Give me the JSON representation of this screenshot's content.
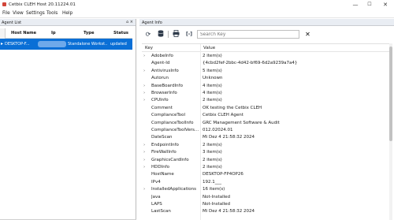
{
  "window": {
    "title": "Cetbix CLEH Host 20.11224.01",
    "minimize": "—",
    "maximize": "☐",
    "close": "✕"
  },
  "menu": [
    "File",
    "View",
    "Settings",
    "Tools",
    "Help"
  ],
  "agent_list": {
    "panel_title": "Agent List",
    "panel_icons": "⌂ ×",
    "columns": [
      "Host Name",
      "Ip",
      "Type",
      "Status"
    ],
    "rows": [
      {
        "host": "DESKTOP-F...",
        "ip": "",
        "type": "Standalone Workst...",
        "status": "updated"
      }
    ]
  },
  "agent_info": {
    "panel_title": "Agent Info",
    "toolbar_icons": [
      "refresh-icon",
      "database-icon",
      "print-icon",
      "code-icon"
    ],
    "search_placeholder": "Search Key",
    "columns": [
      "Key",
      "Value"
    ],
    "properties": [
      {
        "key": "AdobeInfo",
        "value": "2 item(s)",
        "expandable": true
      },
      {
        "key": "Agent-Id",
        "value": "{4cbd2fef-2bbc-4d42-bf69-6d2a9239a7a4}",
        "expandable": false
      },
      {
        "key": "AntivirusInfo",
        "value": "5 item(s)",
        "expandable": true
      },
      {
        "key": "Autorun",
        "value": "Unknown",
        "expandable": false
      },
      {
        "key": "BaseBoardInfo",
        "value": "4 item(s)",
        "expandable": true
      },
      {
        "key": "BrowserInfo",
        "value": "4 item(s)",
        "expandable": true
      },
      {
        "key": "CPUInfo",
        "value": "2 item(s)",
        "expandable": true
      },
      {
        "key": "Comment",
        "value": "OK testing the Cetbix CLEH",
        "expandable": false
      },
      {
        "key": "ComplianceTool",
        "value": "Cetbix CLEH Agent",
        "expandable": false
      },
      {
        "key": "ComplianceToolInfo",
        "value": "GRC Management Software & Audit",
        "expandable": false
      },
      {
        "key": "ComplianceToolVers...",
        "value": "012.02024.01",
        "expandable": false
      },
      {
        "key": "DateScan",
        "value": "Mi Dez 4 21:58:32 2024",
        "expandable": false
      },
      {
        "key": "EndpointInfo",
        "value": "2 item(s)",
        "expandable": true
      },
      {
        "key": "FireWallInfo",
        "value": "3 item(s)",
        "expandable": true
      },
      {
        "key": "GraphicsCardInfo",
        "value": "2 item(s)",
        "expandable": true
      },
      {
        "key": "HDDInfo",
        "value": "2 item(s)",
        "expandable": true
      },
      {
        "key": "HostName",
        "value": "DESKTOP-FP4OP26",
        "expandable": false
      },
      {
        "key": "IPv4",
        "value": "192.1___",
        "expandable": false
      },
      {
        "key": "InstalledApplications",
        "value": "16 item(s)",
        "expandable": true
      },
      {
        "key": "Java",
        "value": "Not-Installed",
        "expandable": false
      },
      {
        "key": "LAPS",
        "value": "Not-Installed",
        "expandable": false
      },
      {
        "key": "LastScan",
        "value": "Mi Dez 4 21:58:32 2024",
        "expandable": false
      }
    ]
  },
  "colors": {
    "selection": "#0a6fd6",
    "panel_header": "#e9edf3"
  }
}
